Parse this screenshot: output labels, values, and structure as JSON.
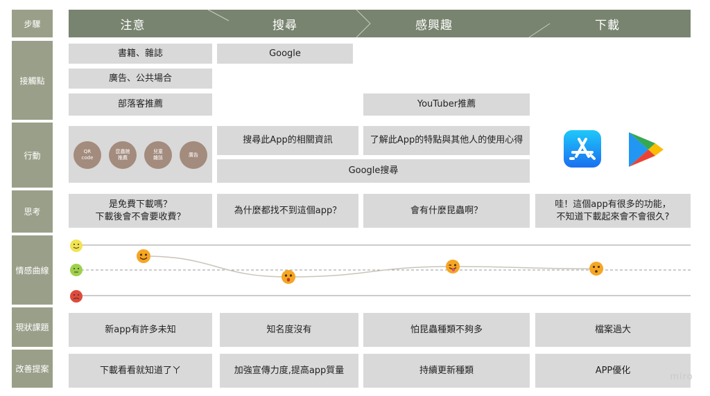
{
  "row_labels": {
    "steps": "步驟",
    "touchpoints": "接觸點",
    "actions": "行動",
    "thoughts": "思考",
    "emotion_curve": "情感曲線",
    "current_issues": "現狀課題",
    "improvements": "改善提案"
  },
  "stages": [
    "注意",
    "搜尋",
    "感興趣",
    "下載"
  ],
  "touchpoints": {
    "books": "書籍、雜誌",
    "ads_public": "廣告、公共場合",
    "blogger": "部落客推薦",
    "google": "Google",
    "youtuber": "YouTuber推薦"
  },
  "actions": {
    "circles": [
      "QR\ncode",
      "昆蟲館\n推薦",
      "兒童\n雜誌",
      "廣告"
    ],
    "search_app": "搜尋此App的相關資訊",
    "learn_features": "了解此App的特點與其他人的使用心得",
    "google_search": "Google搜尋",
    "app_store_icon": "app-store-icon",
    "google_play_icon": "google-play-icon"
  },
  "thoughts": [
    "是免費下載嗎？\n下載後會不會要收費？",
    "為什麼都找不到這個app？",
    "會有什麼昆蟲啊？",
    "哇！這個app有很多的功能，\n不知道下載起來會不會很久?"
  ],
  "emotion_curve": {
    "levels": [
      "happy",
      "neutral",
      "sad"
    ],
    "points": [
      0.6,
      -0.3,
      0.15,
      0.05
    ],
    "emoji_icons": [
      "smile-emoji-icon",
      "surprised-emoji-icon",
      "wink-tongue-emoji-icon",
      "whistle-emoji-icon"
    ]
  },
  "issues": [
    "新app有許多未知",
    "知名度沒有",
    "怕昆蟲種類不夠多",
    "檔案過大"
  ],
  "improvements": [
    "下載看看就知道了ㄚ",
    "加強宣傳力度,提高app質量",
    "持續更新種類",
    "APP優化"
  ],
  "watermark": "miro",
  "colors": {
    "header": "#78846f",
    "row_label": "#9a9f89",
    "box": "#d9d9d9",
    "circle": "#a38b7d"
  }
}
